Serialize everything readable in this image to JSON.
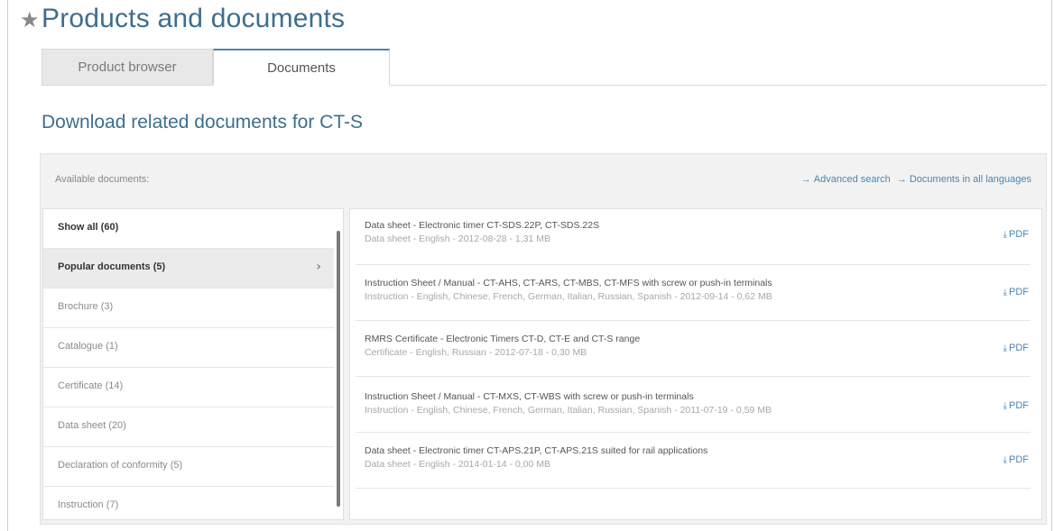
{
  "page": {
    "title": "Products and documents",
    "star": "★"
  },
  "tabs": [
    {
      "label": "Product browser",
      "active": false
    },
    {
      "label": "Documents",
      "active": true
    }
  ],
  "section": {
    "title": "Download related documents for CT-S"
  },
  "toolbar": {
    "available_label": "Available documents:",
    "advanced_search": "Advanced search",
    "all_languages": "Documents in all languages",
    "arrow": "→"
  },
  "filters": [
    {
      "label": "Show all (60)",
      "bold": true
    },
    {
      "label": "Popular documents (5)",
      "bold": true,
      "active": true,
      "chevron": "›"
    },
    {
      "label": "Brochure (3)"
    },
    {
      "label": "Catalogue (1)"
    },
    {
      "label": "Certificate (14)"
    },
    {
      "label": "Data sheet (20)"
    },
    {
      "label": "Declaration of conformity (5)"
    },
    {
      "label": "Instruction (7)"
    }
  ],
  "documents": [
    {
      "title": "Data sheet - Electronic timer CT-SDS.22P, CT-SDS.22S",
      "meta": "Data sheet - English - 2012-08-28 - 1,31 MB",
      "link": "PDF"
    },
    {
      "title": "Instruction Sheet / Manual - CT-AHS, CT-ARS, CT-MBS, CT-MFS with screw or push-in terminals",
      "meta": "Instruction - English, Chinese, French, German, Italian, Russian, Spanish - 2012-09-14 - 0,62 MB",
      "link": "PDF"
    },
    {
      "title": "RMRS Certificate - Electronic Timers CT-D, CT-E and CT-S range",
      "meta": "Certificate - English, Russian - 2012-07-18 - 0,30 MB",
      "link": "PDF"
    },
    {
      "title": "Instruction Sheet / Manual - CT-MXS, CT-WBS with screw or push-in terminals",
      "meta": "Instruction - English, Chinese, French, German, Italian, Russian, Spanish - 2011-07-19 - 0,59 MB",
      "link": "PDF"
    },
    {
      "title": "Data sheet - Electronic timer CT-APS.21P, CT-APS.21S suited for rail applications",
      "meta": "Data sheet - English - 2014-01-14 - 0,00 MB",
      "link": "PDF"
    }
  ],
  "icons": {
    "download": "download-icon",
    "chevron": "chevron-right-icon",
    "star": "star-icon",
    "arrow": "arrow-right-icon"
  },
  "colors": {
    "accent": "#3e6e8f",
    "link": "#4a86b4"
  }
}
